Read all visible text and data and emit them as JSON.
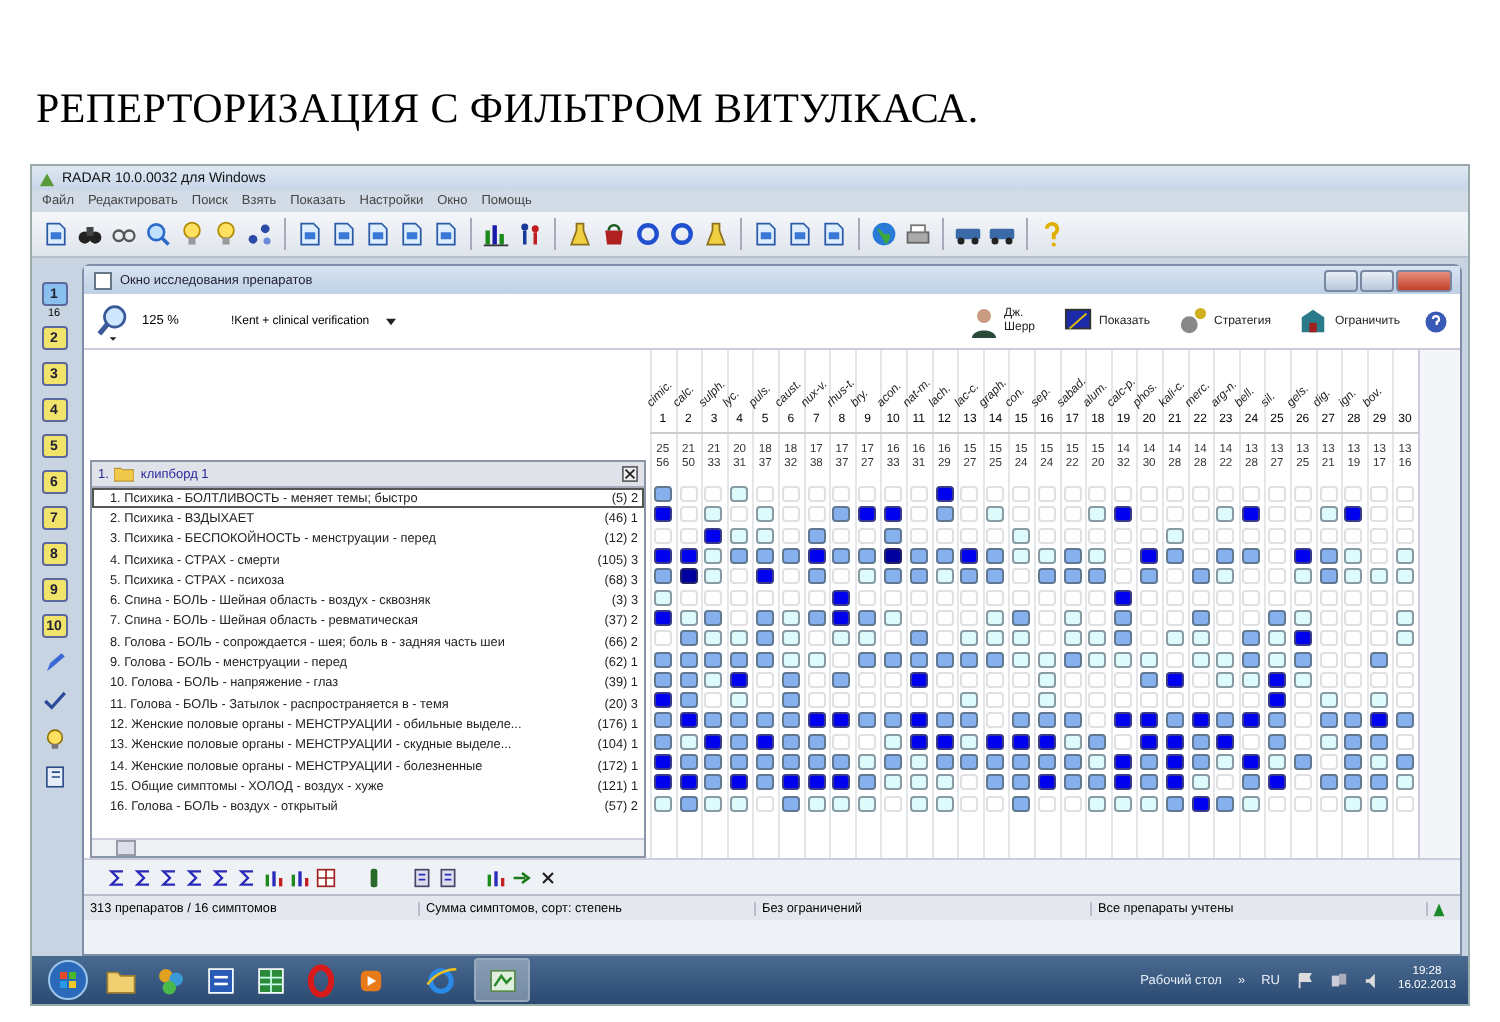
{
  "heading": "РЕПЕРТОРИЗАЦИЯ С ФИЛЬТРОМ  ВИТУЛКАСА.",
  "app": {
    "title": "RADAR 10.0.0032 для Windows",
    "menu": [
      "Файл",
      "Редактировать",
      "Поиск",
      "Взять",
      "Показать",
      "Настройки",
      "Окно",
      "Помощь"
    ]
  },
  "side_toolbar": {
    "book_numbers": [
      "1",
      "2",
      "3",
      "4",
      "5",
      "6",
      "7",
      "8",
      "9",
      "10"
    ],
    "count": "16"
  },
  "analysis_window": {
    "title": "Окно исследования препаратов",
    "zoom": "125 %",
    "repertory": "!Kent + clinical verification",
    "expert": [
      "Дж.",
      "Шерр"
    ],
    "actions": [
      "Показать",
      "Стратегия",
      "Ограничить"
    ]
  },
  "clipboard": {
    "number": "1.",
    "name": "клипборд 1"
  },
  "symptoms": [
    {
      "label": "1. Психика - БОЛТЛИВОСТЬ - меняет темы; быстро",
      "count": "(5) 2",
      "selected": true,
      "cells": [
        {
          "kind": "medium"
        },
        {
          "kind": "empty"
        },
        {
          "kind": "empty"
        },
        {
          "kind": "weak"
        },
        {
          "kind": "empty"
        },
        {
          "kind": "empty"
        },
        {
          "kind": "empty"
        },
        {
          "kind": "empty"
        },
        {
          "kind": "empty"
        },
        {
          "kind": "empty"
        },
        {
          "kind": "empty"
        },
        {
          "kind": "strong"
        },
        {
          "kind": "empty"
        },
        {
          "kind": "empty"
        },
        {
          "kind": "empty"
        },
        {
          "kind": "empty"
        },
        {
          "kind": "empty"
        },
        {
          "kind": "empty"
        },
        {
          "kind": "empty"
        },
        {
          "kind": "empty"
        },
        {
          "kind": "empty"
        },
        {
          "kind": "empty"
        },
        {
          "kind": "empty"
        },
        {
          "kind": "empty"
        },
        {
          "kind": "empty"
        },
        {
          "kind": "empty"
        },
        {
          "kind": "empty"
        },
        {
          "kind": "empty"
        },
        {
          "kind": "empty"
        },
        {
          "kind": "empty"
        }
      ]
    },
    {
      "label": "2. Психика - ВЗДЫХАЕТ",
      "count": "(46) 1",
      "selected": false,
      "cells": [
        {
          "kind": "strong"
        },
        {
          "kind": "empty"
        },
        {
          "kind": "weak"
        },
        {
          "kind": "empty"
        },
        {
          "kind": "weak"
        },
        {
          "kind": "empty"
        },
        {
          "kind": "empty"
        },
        {
          "kind": "medium"
        },
        {
          "kind": "strong"
        },
        {
          "kind": "strong"
        },
        {
          "kind": "empty"
        },
        {
          "kind": "medium"
        },
        {
          "kind": "empty"
        },
        {
          "kind": "weak"
        },
        {
          "kind": "empty"
        },
        {
          "kind": "empty"
        },
        {
          "kind": "empty"
        },
        {
          "kind": "weak"
        },
        {
          "kind": "strong"
        },
        {
          "kind": "empty"
        },
        {
          "kind": "empty"
        },
        {
          "kind": "empty"
        },
        {
          "kind": "weak"
        },
        {
          "kind": "strong"
        },
        {
          "kind": "empty"
        },
        {
          "kind": "empty"
        },
        {
          "kind": "weak"
        },
        {
          "kind": "strong"
        },
        {
          "kind": "empty"
        },
        {
          "kind": "empty"
        }
      ]
    },
    {
      "label": "3. Психика - БЕСПОКОЙНОСТЬ - менструации - перед",
      "count": "(12) 2",
      "selected": false,
      "cells": [
        {
          "kind": "empty"
        },
        {
          "kind": "empty"
        },
        {
          "kind": "strong"
        },
        {
          "kind": "weak"
        },
        {
          "kind": "weak"
        },
        {
          "kind": "empty"
        },
        {
          "kind": "medium"
        },
        {
          "kind": "empty"
        },
        {
          "kind": "empty"
        },
        {
          "kind": "medium"
        },
        {
          "kind": "empty"
        },
        {
          "kind": "empty"
        },
        {
          "kind": "empty"
        },
        {
          "kind": "empty"
        },
        {
          "kind": "weak"
        },
        {
          "kind": "empty"
        },
        {
          "kind": "empty"
        },
        {
          "kind": "empty"
        },
        {
          "kind": "empty"
        },
        {
          "kind": "empty"
        },
        {
          "kind": "weak"
        },
        {
          "kind": "empty"
        },
        {
          "kind": "empty"
        },
        {
          "kind": "empty"
        },
        {
          "kind": "empty"
        },
        {
          "kind": "empty"
        },
        {
          "kind": "empty"
        },
        {
          "kind": "empty"
        },
        {
          "kind": "empty"
        },
        {
          "kind": "empty"
        }
      ]
    },
    {
      "label": "4. Психика - СТРАХ - смерти",
      "count": "(105) 3",
      "selected": false,
      "cells": [
        {
          "kind": "strong"
        },
        {
          "kind": "strong"
        },
        {
          "kind": "weak"
        },
        {
          "kind": "medium"
        },
        {
          "kind": "medium"
        },
        {
          "kind": "medium"
        },
        {
          "kind": "strong"
        },
        {
          "kind": "medium"
        },
        {
          "kind": "medium"
        },
        {
          "kind": "max"
        },
        {
          "kind": "medium"
        },
        {
          "kind": "medium"
        },
        {
          "kind": "strong"
        },
        {
          "kind": "medium"
        },
        {
          "kind": "weak"
        },
        {
          "kind": "weak"
        },
        {
          "kind": "medium"
        },
        {
          "kind": "weak"
        },
        {
          "kind": "empty"
        },
        {
          "kind": "strong"
        },
        {
          "kind": "medium"
        },
        {
          "kind": "empty"
        },
        {
          "kind": "medium"
        },
        {
          "kind": "medium"
        },
        {
          "kind": "empty"
        },
        {
          "kind": "strong"
        },
        {
          "kind": "medium"
        },
        {
          "kind": "weak"
        },
        {
          "kind": "empty"
        },
        {
          "kind": "weak"
        }
      ]
    },
    {
      "label": "5. Психика - СТРАХ - психоза",
      "count": "(68) 3",
      "selected": false,
      "cells": [
        {
          "kind": "medium"
        },
        {
          "kind": "max"
        },
        {
          "kind": "weak"
        },
        {
          "kind": "empty"
        },
        {
          "kind": "strong"
        },
        {
          "kind": "empty"
        },
        {
          "kind": "medium"
        },
        {
          "kind": "empty"
        },
        {
          "kind": "weak"
        },
        {
          "kind": "medium"
        },
        {
          "kind": "medium"
        },
        {
          "kind": "weak"
        },
        {
          "kind": "medium"
        },
        {
          "kind": "medium"
        },
        {
          "kind": "empty"
        },
        {
          "kind": "medium"
        },
        {
          "kind": "medium"
        },
        {
          "kind": "medium"
        },
        {
          "kind": "empty"
        },
        {
          "kind": "medium"
        },
        {
          "kind": "empty"
        },
        {
          "kind": "medium"
        },
        {
          "kind": "weak"
        },
        {
          "kind": "empty"
        },
        {
          "kind": "empty"
        },
        {
          "kind": "weak"
        },
        {
          "kind": "medium"
        },
        {
          "kind": "weak"
        },
        {
          "kind": "weak"
        },
        {
          "kind": "weak"
        }
      ]
    },
    {
      "label": "6. Спина - БОЛЬ - Шейная область - воздух - сквозняк",
      "count": "(3) 3",
      "selected": false,
      "cells": [
        {
          "kind": "weak"
        },
        {
          "kind": "empty"
        },
        {
          "kind": "empty"
        },
        {
          "kind": "empty"
        },
        {
          "kind": "empty"
        },
        {
          "kind": "empty"
        },
        {
          "kind": "empty"
        },
        {
          "kind": "strong"
        },
        {
          "kind": "empty"
        },
        {
          "kind": "empty"
        },
        {
          "kind": "empty"
        },
        {
          "kind": "empty"
        },
        {
          "kind": "empty"
        },
        {
          "kind": "empty"
        },
        {
          "kind": "empty"
        },
        {
          "kind": "empty"
        },
        {
          "kind": "empty"
        },
        {
          "kind": "empty"
        },
        {
          "kind": "strong"
        },
        {
          "kind": "empty"
        },
        {
          "kind": "empty"
        },
        {
          "kind": "empty"
        },
        {
          "kind": "empty"
        },
        {
          "kind": "empty"
        },
        {
          "kind": "empty"
        },
        {
          "kind": "empty"
        },
        {
          "kind": "empty"
        },
        {
          "kind": "empty"
        },
        {
          "kind": "empty"
        },
        {
          "kind": "empty"
        }
      ]
    },
    {
      "label": "7. Спина - БОЛЬ - Шейная область - ревматическая",
      "count": "(37) 2",
      "selected": false,
      "cells": [
        {
          "kind": "strong"
        },
        {
          "kind": "weak"
        },
        {
          "kind": "medium"
        },
        {
          "kind": "empty"
        },
        {
          "kind": "medium"
        },
        {
          "kind": "weak"
        },
        {
          "kind": "medium"
        },
        {
          "kind": "strong"
        },
        {
          "kind": "medium"
        },
        {
          "kind": "weak"
        },
        {
          "kind": "empty"
        },
        {
          "kind": "empty"
        },
        {
          "kind": "empty"
        },
        {
          "kind": "weak"
        },
        {
          "kind": "medium"
        },
        {
          "kind": "empty"
        },
        {
          "kind": "weak"
        },
        {
          "kind": "empty"
        },
        {
          "kind": "medium"
        },
        {
          "kind": "empty"
        },
        {
          "kind": "empty"
        },
        {
          "kind": "medium"
        },
        {
          "kind": "empty"
        },
        {
          "kind": "empty"
        },
        {
          "kind": "medium"
        },
        {
          "kind": "weak"
        },
        {
          "kind": "empty"
        },
        {
          "kind": "empty"
        },
        {
          "kind": "empty"
        },
        {
          "kind": "weak"
        }
      ]
    },
    {
      "label": "8. Голова - БОЛЬ - сопрождается - шея; боль в - задняя часть шеи",
      "count": "(66) 2",
      "selected": false,
      "cells": [
        {
          "kind": "empty"
        },
        {
          "kind": "medium"
        },
        {
          "kind": "weak"
        },
        {
          "kind": "weak"
        },
        {
          "kind": "medium"
        },
        {
          "kind": "weak"
        },
        {
          "kind": "empty"
        },
        {
          "kind": "weak"
        },
        {
          "kind": "weak"
        },
        {
          "kind": "empty"
        },
        {
          "kind": "medium"
        },
        {
          "kind": "empty"
        },
        {
          "kind": "weak"
        },
        {
          "kind": "weak"
        },
        {
          "kind": "weak"
        },
        {
          "kind": "empty"
        },
        {
          "kind": "weak"
        },
        {
          "kind": "weak"
        },
        {
          "kind": "medium"
        },
        {
          "kind": "empty"
        },
        {
          "kind": "weak"
        },
        {
          "kind": "weak"
        },
        {
          "kind": "empty"
        },
        {
          "kind": "medium"
        },
        {
          "kind": "weak"
        },
        {
          "kind": "strong"
        },
        {
          "kind": "empty"
        },
        {
          "kind": "empty"
        },
        {
          "kind": "empty"
        },
        {
          "kind": "weak"
        }
      ]
    },
    {
      "label": "9. Голова - БОЛЬ - менструации - перед",
      "count": "(62) 1",
      "selected": false,
      "cells": [
        {
          "kind": "medium"
        },
        {
          "kind": "medium"
        },
        {
          "kind": "medium"
        },
        {
          "kind": "medium"
        },
        {
          "kind": "medium"
        },
        {
          "kind": "weak"
        },
        {
          "kind": "weak"
        },
        {
          "kind": "empty"
        },
        {
          "kind": "medium"
        },
        {
          "kind": "medium"
        },
        {
          "kind": "medium"
        },
        {
          "kind": "medium"
        },
        {
          "kind": "medium"
        },
        {
          "kind": "medium"
        },
        {
          "kind": "weak"
        },
        {
          "kind": "weak"
        },
        {
          "kind": "medium"
        },
        {
          "kind": "weak"
        },
        {
          "kind": "weak"
        },
        {
          "kind": "weak"
        },
        {
          "kind": "empty"
        },
        {
          "kind": "weak"
        },
        {
          "kind": "weak"
        },
        {
          "kind": "medium"
        },
        {
          "kind": "weak"
        },
        {
          "kind": "medium"
        },
        {
          "kind": "empty"
        },
        {
          "kind": "empty"
        },
        {
          "kind": "medium"
        },
        {
          "kind": "empty"
        }
      ]
    },
    {
      "label": "10. Голова - БОЛЬ - напряжение - глаз",
      "count": "(39) 1",
      "selected": false,
      "cells": [
        {
          "kind": "medium"
        },
        {
          "kind": "medium"
        },
        {
          "kind": "weak"
        },
        {
          "kind": "strong"
        },
        {
          "kind": "empty"
        },
        {
          "kind": "medium"
        },
        {
          "kind": "empty"
        },
        {
          "kind": "medium"
        },
        {
          "kind": "empty"
        },
        {
          "kind": "empty"
        },
        {
          "kind": "strong"
        },
        {
          "kind": "empty"
        },
        {
          "kind": "empty"
        },
        {
          "kind": "empty"
        },
        {
          "kind": "empty"
        },
        {
          "kind": "weak"
        },
        {
          "kind": "empty"
        },
        {
          "kind": "empty"
        },
        {
          "kind": "empty"
        },
        {
          "kind": "medium"
        },
        {
          "kind": "strong"
        },
        {
          "kind": "empty"
        },
        {
          "kind": "weak"
        },
        {
          "kind": "weak"
        },
        {
          "kind": "strong"
        },
        {
          "kind": "weak"
        },
        {
          "kind": "empty"
        },
        {
          "kind": "empty"
        },
        {
          "kind": "empty"
        },
        {
          "kind": "empty"
        }
      ]
    },
    {
      "label": "11. Голова - БОЛЬ - Затылок - распространяется в - темя",
      "count": "(20) 3",
      "selected": false,
      "cells": [
        {
          "kind": "strong"
        },
        {
          "kind": "medium"
        },
        {
          "kind": "empty"
        },
        {
          "kind": "weak"
        },
        {
          "kind": "empty"
        },
        {
          "kind": "medium"
        },
        {
          "kind": "empty"
        },
        {
          "kind": "empty"
        },
        {
          "kind": "empty"
        },
        {
          "kind": "empty"
        },
        {
          "kind": "empty"
        },
        {
          "kind": "empty"
        },
        {
          "kind": "weak"
        },
        {
          "kind": "empty"
        },
        {
          "kind": "empty"
        },
        {
          "kind": "weak"
        },
        {
          "kind": "empty"
        },
        {
          "kind": "empty"
        },
        {
          "kind": "empty"
        },
        {
          "kind": "empty"
        },
        {
          "kind": "empty"
        },
        {
          "kind": "empty"
        },
        {
          "kind": "empty"
        },
        {
          "kind": "empty"
        },
        {
          "kind": "strong"
        },
        {
          "kind": "empty"
        },
        {
          "kind": "weak"
        },
        {
          "kind": "empty"
        },
        {
          "kind": "weak"
        },
        {
          "kind": "empty"
        }
      ]
    },
    {
      "label": "12. Женские половые органы - МЕНСТРУАЦИИ - обильные выделе...",
      "count": "(176) 1",
      "selected": false,
      "cells": [
        {
          "kind": "medium"
        },
        {
          "kind": "strong"
        },
        {
          "kind": "medium"
        },
        {
          "kind": "medium"
        },
        {
          "kind": "medium"
        },
        {
          "kind": "medium"
        },
        {
          "kind": "strong"
        },
        {
          "kind": "strong"
        },
        {
          "kind": "medium"
        },
        {
          "kind": "medium"
        },
        {
          "kind": "strong"
        },
        {
          "kind": "medium"
        },
        {
          "kind": "medium"
        },
        {
          "kind": "empty"
        },
        {
          "kind": "medium"
        },
        {
          "kind": "medium"
        },
        {
          "kind": "medium"
        },
        {
          "kind": "empty"
        },
        {
          "kind": "strong"
        },
        {
          "kind": "strong"
        },
        {
          "kind": "medium"
        },
        {
          "kind": "strong"
        },
        {
          "kind": "medium"
        },
        {
          "kind": "strong"
        },
        {
          "kind": "medium"
        },
        {
          "kind": "empty"
        },
        {
          "kind": "medium"
        },
        {
          "kind": "medium"
        },
        {
          "kind": "strong"
        },
        {
          "kind": "medium"
        }
      ]
    },
    {
      "label": "13. Женские половые органы - МЕНСТРУАЦИИ - скудные выделе...",
      "count": "(104) 1",
      "selected": false,
      "cells": [
        {
          "kind": "medium"
        },
        {
          "kind": "weak"
        },
        {
          "kind": "strong"
        },
        {
          "kind": "medium"
        },
        {
          "kind": "strong"
        },
        {
          "kind": "medium"
        },
        {
          "kind": "medium"
        },
        {
          "kind": "empty"
        },
        {
          "kind": "empty"
        },
        {
          "kind": "weak"
        },
        {
          "kind": "strong"
        },
        {
          "kind": "strong"
        },
        {
          "kind": "weak"
        },
        {
          "kind": "strong"
        },
        {
          "kind": "strong"
        },
        {
          "kind": "strong"
        },
        {
          "kind": "weak"
        },
        {
          "kind": "medium"
        },
        {
          "kind": "empty"
        },
        {
          "kind": "strong"
        },
        {
          "kind": "strong"
        },
        {
          "kind": "medium"
        },
        {
          "kind": "strong"
        },
        {
          "kind": "empty"
        },
        {
          "kind": "medium"
        },
        {
          "kind": "empty"
        },
        {
          "kind": "weak"
        },
        {
          "kind": "medium"
        },
        {
          "kind": "medium"
        },
        {
          "kind": "empty"
        }
      ]
    },
    {
      "label": "14. Женские половые органы - МЕНСТРУАЦИИ - болезненные",
      "count": "(172) 1",
      "selected": false,
      "cells": [
        {
          "kind": "strong"
        },
        {
          "kind": "medium"
        },
        {
          "kind": "medium"
        },
        {
          "kind": "medium"
        },
        {
          "kind": "medium"
        },
        {
          "kind": "medium"
        },
        {
          "kind": "medium"
        },
        {
          "kind": "medium"
        },
        {
          "kind": "weak"
        },
        {
          "kind": "medium"
        },
        {
          "kind": "weak"
        },
        {
          "kind": "medium"
        },
        {
          "kind": "medium"
        },
        {
          "kind": "medium"
        },
        {
          "kind": "medium"
        },
        {
          "kind": "medium"
        },
        {
          "kind": "medium"
        },
        {
          "kind": "weak"
        },
        {
          "kind": "strong"
        },
        {
          "kind": "medium"
        },
        {
          "kind": "strong"
        },
        {
          "kind": "medium"
        },
        {
          "kind": "weak"
        },
        {
          "kind": "strong"
        },
        {
          "kind": "weak"
        },
        {
          "kind": "medium"
        },
        {
          "kind": "empty"
        },
        {
          "kind": "medium"
        },
        {
          "kind": "weak"
        },
        {
          "kind": "medium"
        }
      ]
    },
    {
      "label": "15. Общие симптомы - ХОЛОД - воздух - хуже",
      "count": "(121) 1",
      "selected": false,
      "cells": [
        {
          "kind": "strong"
        },
        {
          "kind": "strong"
        },
        {
          "kind": "medium"
        },
        {
          "kind": "strong"
        },
        {
          "kind": "medium"
        },
        {
          "kind": "strong"
        },
        {
          "kind": "strong"
        },
        {
          "kind": "strong"
        },
        {
          "kind": "medium"
        },
        {
          "kind": "weak"
        },
        {
          "kind": "weak"
        },
        {
          "kind": "weak"
        },
        {
          "kind": "empty"
        },
        {
          "kind": "medium"
        },
        {
          "kind": "medium"
        },
        {
          "kind": "strong"
        },
        {
          "kind": "medium"
        },
        {
          "kind": "medium"
        },
        {
          "kind": "strong"
        },
        {
          "kind": "medium"
        },
        {
          "kind": "strong"
        },
        {
          "kind": "weak"
        },
        {
          "kind": "empty"
        },
        {
          "kind": "medium"
        },
        {
          "kind": "strong"
        },
        {
          "kind": "empty"
        },
        {
          "kind": "medium"
        },
        {
          "kind": "medium"
        },
        {
          "kind": "medium"
        },
        {
          "kind": "weak"
        }
      ]
    },
    {
      "label": "16. Голова - БОЛЬ - воздух - открытый",
      "count": "(57) 2",
      "selected": false,
      "cells": [
        {
          "kind": "weak"
        },
        {
          "kind": "medium"
        },
        {
          "kind": "weak"
        },
        {
          "kind": "weak"
        },
        {
          "kind": "empty"
        },
        {
          "kind": "medium"
        },
        {
          "kind": "weak"
        },
        {
          "kind": "weak"
        },
        {
          "kind": "weak"
        },
        {
          "kind": "empty"
        },
        {
          "kind": "weak"
        },
        {
          "kind": "weak"
        },
        {
          "kind": "empty"
        },
        {
          "kind": "empty"
        },
        {
          "kind": "medium"
        },
        {
          "kind": "empty"
        },
        {
          "kind": "empty"
        },
        {
          "kind": "weak"
        },
        {
          "kind": "weak"
        },
        {
          "kind": "weak"
        },
        {
          "kind": "medium"
        },
        {
          "kind": "strong"
        },
        {
          "kind": "medium"
        },
        {
          "kind": "weak"
        },
        {
          "kind": "empty"
        },
        {
          "kind": "empty"
        },
        {
          "kind": "empty"
        },
        {
          "kind": "weak"
        },
        {
          "kind": "weak"
        },
        {
          "kind": "empty"
        }
      ]
    }
  ],
  "remedies": [
    {
      "abbrev": "cimic.",
      "number": "1",
      "score": "25",
      "sum": "56"
    },
    {
      "abbrev": "calc.",
      "number": "2",
      "score": "21",
      "sum": "50"
    },
    {
      "abbrev": "sulph.",
      "number": "3",
      "score": "21",
      "sum": "33"
    },
    {
      "abbrev": "lyc.",
      "number": "4",
      "score": "20",
      "sum": "31"
    },
    {
      "abbrev": "puls.",
      "number": "5",
      "score": "18",
      "sum": "37"
    },
    {
      "abbrev": "caust.",
      "number": "6",
      "score": "18",
      "sum": "32"
    },
    {
      "abbrev": "nux-v.",
      "number": "7",
      "score": "17",
      "sum": "38"
    },
    {
      "abbrev": "rhus-t.",
      "number": "8",
      "score": "17",
      "sum": "37"
    },
    {
      "abbrev": "bry.",
      "number": "9",
      "score": "17",
      "sum": "27"
    },
    {
      "abbrev": "acon.",
      "number": "10",
      "score": "16",
      "sum": "33"
    },
    {
      "abbrev": "nat-m.",
      "number": "11",
      "score": "16",
      "sum": "31"
    },
    {
      "abbrev": "lach.",
      "number": "12",
      "score": "16",
      "sum": "29"
    },
    {
      "abbrev": "lac-c.",
      "number": "13",
      "score": "15",
      "sum": "27"
    },
    {
      "abbrev": "graph.",
      "number": "14",
      "score": "15",
      "sum": "25"
    },
    {
      "abbrev": "con.",
      "number": "15",
      "score": "15",
      "sum": "24"
    },
    {
      "abbrev": "sep.",
      "number": "16",
      "score": "15",
      "sum": "24"
    },
    {
      "abbrev": "sabad.",
      "number": "17",
      "score": "15",
      "sum": "22"
    },
    {
      "abbrev": "alum.",
      "number": "18",
      "score": "15",
      "sum": "20"
    },
    {
      "abbrev": "calc-p.",
      "number": "19",
      "score": "14",
      "sum": "32"
    },
    {
      "abbrev": "phos.",
      "number": "20",
      "score": "14",
      "sum": "30"
    },
    {
      "abbrev": "kali-c.",
      "number": "21",
      "score": "14",
      "sum": "28"
    },
    {
      "abbrev": "merc.",
      "number": "22",
      "score": "14",
      "sum": "28"
    },
    {
      "abbrev": "arg-n.",
      "number": "23",
      "score": "14",
      "sum": "22"
    },
    {
      "abbrev": "bell.",
      "number": "24",
      "score": "13",
      "sum": "28"
    },
    {
      "abbrev": "sil.",
      "number": "25",
      "score": "13",
      "sum": "27"
    },
    {
      "abbrev": "gels.",
      "number": "26",
      "score": "13",
      "sum": "25"
    },
    {
      "abbrev": "dig.",
      "number": "27",
      "score": "13",
      "sum": "21"
    },
    {
      "abbrev": "ign.",
      "number": "28",
      "score": "13",
      "sum": "19"
    },
    {
      "abbrev": "bov.",
      "number": "29",
      "score": "13",
      "sum": "17"
    },
    {
      "number": "30",
      "score": "13",
      "sum": "16"
    }
  ],
  "status_bar": [
    "313 препаратов / 16 симптомов",
    "Сумма симптомов, сорт: степень",
    "Без ограничений",
    "Все препараты учтены"
  ],
  "taskbar": {
    "desktop": "Рабочий стол",
    "chevron": "»",
    "language": "RU",
    "time": "19:28",
    "date": "16.02.2013"
  }
}
